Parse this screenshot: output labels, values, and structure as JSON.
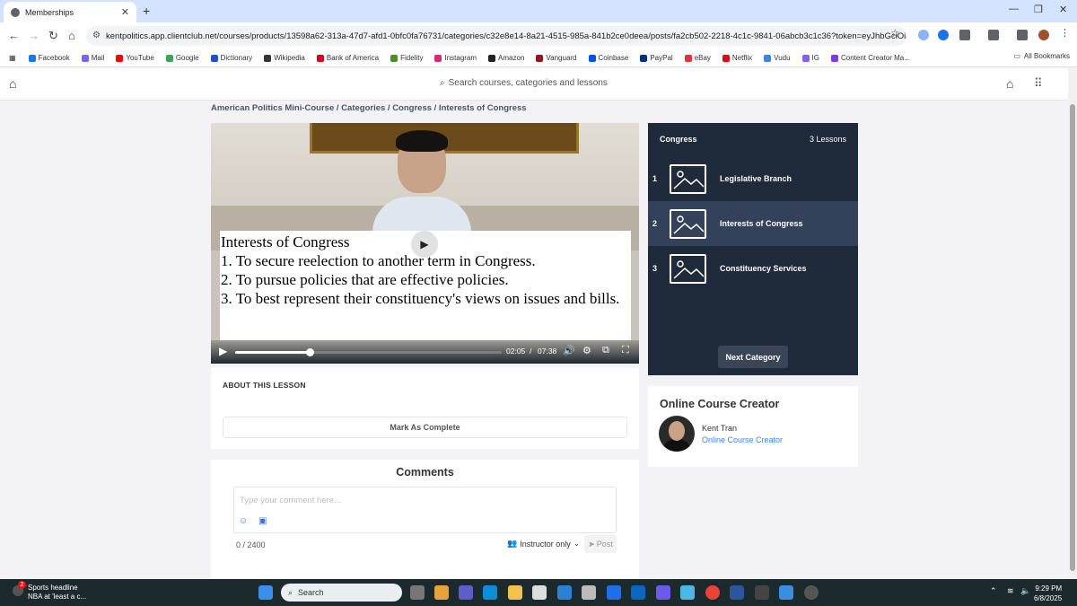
{
  "browser": {
    "tab_title": "Memberships",
    "url": "kentpolitics.app.clientclub.net/courses/products/13598a62-313a-47d7-afd1-0bfc0fa76731/categories/c32e8e14-8a21-4515-985a-841b2ce0deea/posts/fa2cb502-2218-4c1c-9841-06abcb3c1c36?token=eyJhbGciOiJSUzI1Nils...",
    "bookmarks": [
      {
        "label": "Facebook",
        "color": "#1877f2"
      },
      {
        "label": "Mail",
        "color": "#7b61ff"
      },
      {
        "label": "YouTube",
        "color": "#ff0000"
      },
      {
        "label": "Google",
        "color": "#34a853"
      },
      {
        "label": "Dictionary",
        "color": "#1d4ed8"
      },
      {
        "label": "Wikipedia",
        "color": "#333333"
      },
      {
        "label": "Bank of America",
        "color": "#d4001a"
      },
      {
        "label": "Fidelity",
        "color": "#4a8f29"
      },
      {
        "label": "Instagram",
        "color": "#d62976"
      },
      {
        "label": "Amazon",
        "color": "#222222"
      },
      {
        "label": "Vanguard",
        "color": "#96151d"
      },
      {
        "label": "Coinbase",
        "color": "#0052ff"
      },
      {
        "label": "PayPal",
        "color": "#003087"
      },
      {
        "label": "eBay",
        "color": "#e53238"
      },
      {
        "label": "Netflix",
        "color": "#e50914"
      },
      {
        "label": "Vudu",
        "color": "#3b82f6"
      },
      {
        "label": "IG",
        "color": "#8b5cf6"
      },
      {
        "label": "Content Creator Ma...",
        "color": "#7c3aed"
      }
    ],
    "all_bookmarks": "All Bookmarks"
  },
  "header": {
    "search_placeholder": "Search courses, categories and lessons"
  },
  "breadcrumb": "American Politics Mini-Course / Categories / Congress / Interests of Congress",
  "video": {
    "slide_lines": [
      "Interests of Congress",
      "1. To secure reelection to another term in Congress.",
      "2. To pursue policies that are effective policies.",
      "3. To best represent their constituency's views on issues and bills."
    ],
    "current_time": "02:05",
    "separator": "/",
    "duration": "07:38",
    "progress": 0.28
  },
  "about": {
    "title": "ABOUT THIS LESSON",
    "mark_complete": "Mark As Complete"
  },
  "comments": {
    "title": "Comments",
    "placeholder": "Type your comment here...",
    "counter": "0 / 2400",
    "visibility": "Instructor only",
    "post": "Post"
  },
  "lessons": {
    "category": "Congress",
    "count": "3 Lessons",
    "items": [
      {
        "num": "1",
        "name": "Legislative Branch"
      },
      {
        "num": "2",
        "name": "Interests of Congress"
      },
      {
        "num": "3",
        "name": "Constituency Services"
      }
    ],
    "next": "Next Category"
  },
  "creator": {
    "title": "Online Course Creator",
    "name": "Kent Tran",
    "role": "Online Course Creator"
  },
  "taskbar": {
    "news_title": "Sports headline",
    "news_sub": "NBA at 'least a c...",
    "news_badge": "2",
    "search": "Search",
    "time": "9:29 PM",
    "date": "6/8/2025"
  }
}
